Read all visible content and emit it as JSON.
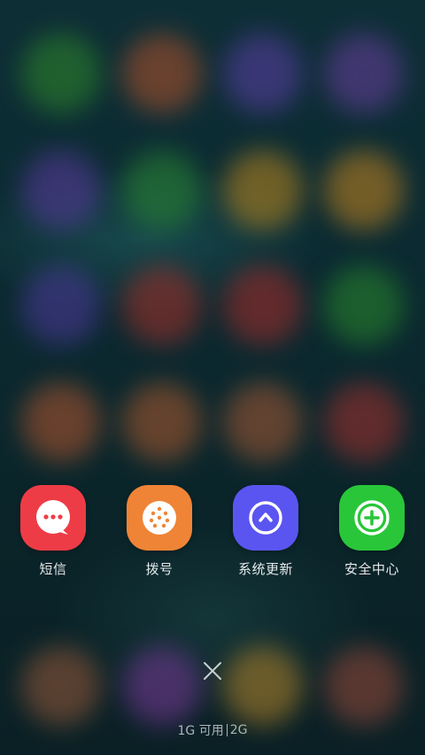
{
  "apps": [
    {
      "label": "短信",
      "icon": "message-dots-icon",
      "color": "#ee3c46"
    },
    {
      "label": "拨号",
      "icon": "dialpad-icon",
      "color": "#ef8436"
    },
    {
      "label": "系统更新",
      "icon": "update-arrow-icon",
      "color": "#5a55f1"
    },
    {
      "label": "安全中心",
      "icon": "shield-plus-icon",
      "color": "#29c639"
    }
  ],
  "memory": {
    "available": "1G 可用",
    "total": "2G"
  }
}
